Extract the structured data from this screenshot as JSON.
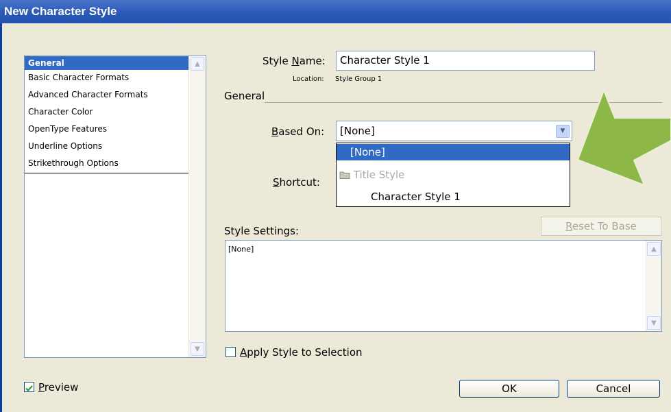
{
  "window": {
    "title": "New Character Style"
  },
  "sidebar": {
    "items": [
      {
        "label": "General",
        "selected": true
      },
      {
        "label": "Basic Character Formats"
      },
      {
        "label": "Advanced Character Formats"
      },
      {
        "label": "Character Color"
      },
      {
        "label": "OpenType Features"
      },
      {
        "label": "Underline Options"
      },
      {
        "label": "Strikethrough Options"
      }
    ]
  },
  "form": {
    "style_name_label_pre": "Style ",
    "style_name_label_u": "N",
    "style_name_label_post": "ame:",
    "style_name_value": "Character Style 1",
    "location_label": "Location:",
    "location_value": "Style Group 1",
    "section_heading": "General",
    "based_on_label_u": "B",
    "based_on_label_post": "ased On:",
    "based_on_value": "[None]",
    "shortcut_label_u": "S",
    "shortcut_label_post": "hortcut:",
    "style_settings_label": "Style Settings:",
    "style_settings_text": "[None]",
    "reset_button_u": "R",
    "reset_button_post": "eset To Base"
  },
  "dropdown": {
    "options": [
      {
        "label": "[None]",
        "selected": true
      },
      {
        "label": "Title Style",
        "icon": "folder-icon",
        "disabled": true
      },
      {
        "label": "Character Style 1"
      }
    ]
  },
  "footer": {
    "apply_u": "A",
    "apply_post": "pply Style to Selection",
    "apply_checked": false,
    "preview_u": "P",
    "preview_post": "review",
    "preview_checked": true,
    "ok_label": "OK",
    "cancel_label": "Cancel"
  },
  "colors": {
    "titlebar": "#2a5ab7",
    "selection": "#316ac5",
    "dialog_bg": "#ece9d8",
    "arrow": "#8db848"
  }
}
